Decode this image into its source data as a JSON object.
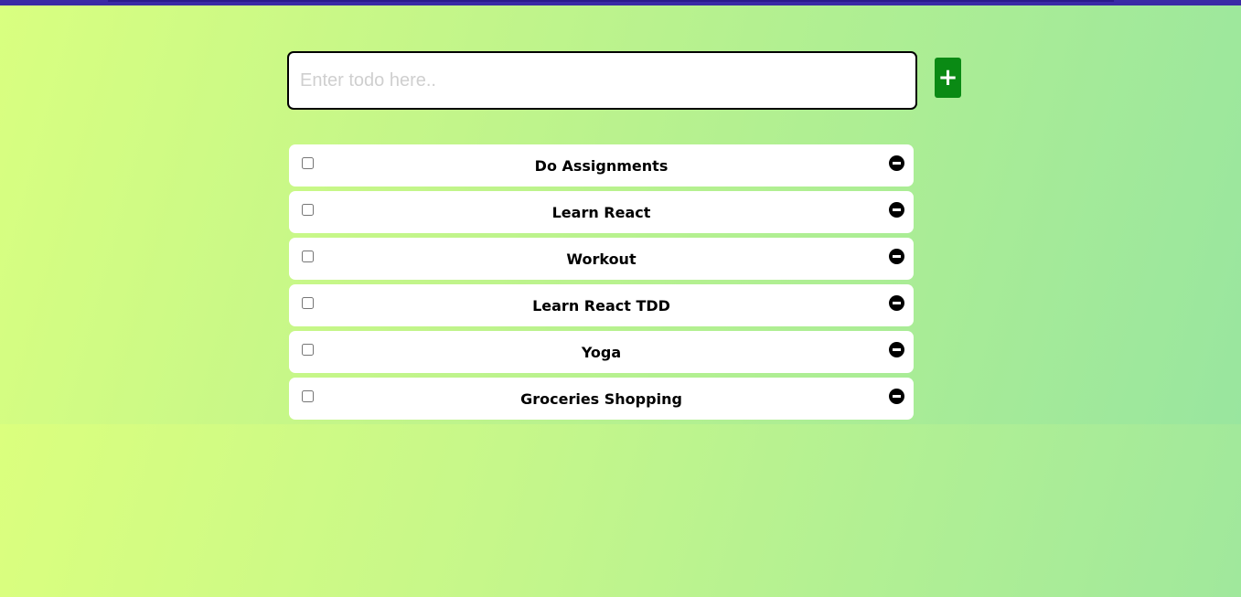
{
  "input": {
    "placeholder": "Enter todo here..",
    "value": ""
  },
  "add_button": {
    "label": "+",
    "color": "#0a8a14"
  },
  "todos": [
    {
      "label": "Do Assignments",
      "checked": false
    },
    {
      "label": "Learn React",
      "checked": false
    },
    {
      "label": "Workout",
      "checked": false
    },
    {
      "label": "Learn React TDD",
      "checked": false
    },
    {
      "label": "Yoga",
      "checked": false
    },
    {
      "label": "Groceries Shopping",
      "checked": false
    }
  ],
  "icons": {
    "remove": "minus-circle-icon"
  },
  "colors": {
    "top_bar": "#3a2aa6",
    "background_start": "#d9ff80",
    "background_end": "#97e5a0"
  }
}
